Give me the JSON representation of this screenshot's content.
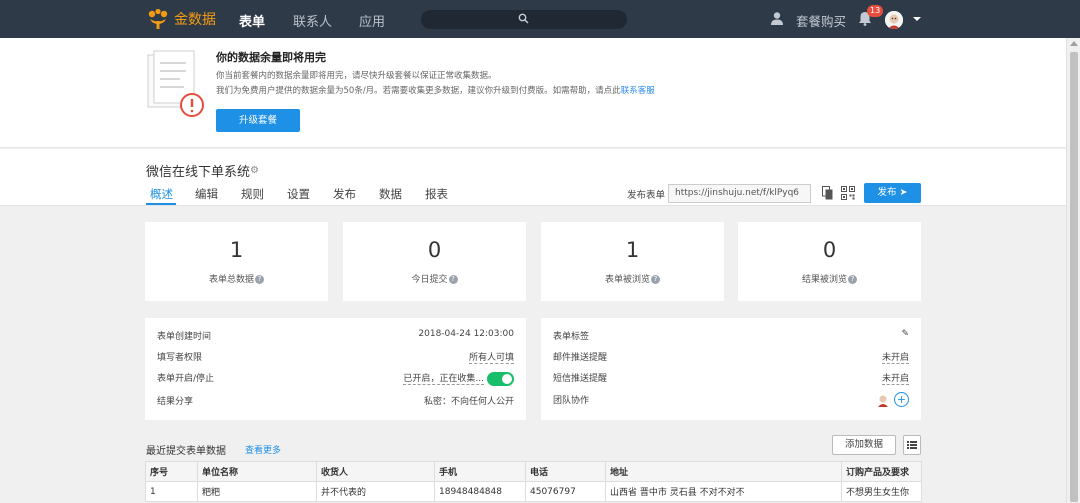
{
  "nav": {
    "brand": "金数据",
    "items": [
      "表单",
      "联系人",
      "应用"
    ],
    "package_label": "套餐购买",
    "notification_count": "13"
  },
  "notice": {
    "title": "你的数据余量即将用完",
    "line1": "你当前套餐内的数据余量即将用完，请尽快升级套餐以保证正常收集数据。",
    "line2": "我们为免费用户提供的数据余量为50条/月。若需要收集更多数据，建议你升级到付费版。如需帮助，请点此",
    "link": "联系客服",
    "button": "升级套餐"
  },
  "form": {
    "title": "微信在线下单系统",
    "tabs": [
      "概述",
      "编辑",
      "规则",
      "设置",
      "发布",
      "数据",
      "报表"
    ],
    "publish_label": "发布表单",
    "publish_url": "https://jinshuju.net/f/klPyq6",
    "publish_button": "发布"
  },
  "stats": [
    {
      "value": "1",
      "label": "表单总数据"
    },
    {
      "value": "0",
      "label": "今日提交"
    },
    {
      "value": "1",
      "label": "表单被浏览"
    },
    {
      "value": "0",
      "label": "结果被浏览"
    }
  ],
  "info_left": [
    {
      "key": "表单创建时间",
      "value": "2018-04-24 12:03:00"
    },
    {
      "key": "填写者权限",
      "value": "所有人可填"
    },
    {
      "key": "表单开启/停止",
      "value": "已开启，正在收集..."
    },
    {
      "key": "结果分享",
      "value": "私密：不向任何人公开"
    }
  ],
  "info_right": [
    {
      "key": "表单标签",
      "value": ""
    },
    {
      "key": "邮件推送提醒",
      "value": "未开启"
    },
    {
      "key": "短信推送提醒",
      "value": "未开启"
    },
    {
      "key": "团队协作",
      "value": ""
    }
  ],
  "recent": {
    "title": "最近提交表单数据",
    "more": "查看更多",
    "add_button": "添加数据",
    "columns": [
      "序号",
      "单位名称",
      "收货人",
      "手机",
      "电话",
      "地址",
      "订购产品及要求"
    ],
    "rows": [
      [
        "1",
        "粑粑",
        "并不代表的",
        "18948484848",
        "45076797",
        "山西省 晋中市 灵石县 不对不对不",
        "不想男生女生你"
      ]
    ]
  },
  "colors": {
    "nav_bg": "#2f3a48",
    "accent": "#1e90e6",
    "brand": "#f39c12",
    "toggle_on": "#19be6b",
    "badge": "#e74c3c"
  }
}
